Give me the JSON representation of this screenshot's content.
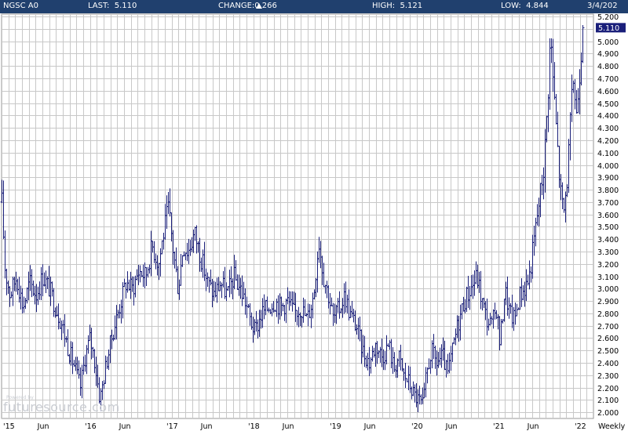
{
  "header": {
    "symbol": "NGSC A0",
    "last_label": "LAST:",
    "last_value": "5.110",
    "change_label": "CHANGE:",
    "change_value": "0.266",
    "change_direction": "up",
    "high_label": "HIGH:",
    "high_value": "5.121",
    "low_label": "LOW:",
    "low_value": "4.844",
    "date": "3/4/202"
  },
  "watermark": {
    "text": "futuresource.com",
    "small": "Powered by"
  },
  "colors": {
    "header_bg": "#20406e",
    "bars": "#1a1f7a",
    "grid": "#c8c8c8",
    "last_badge": "#1a1f7a"
  },
  "chart_data": {
    "type": "ohlc",
    "period": "Weekly",
    "ylim": [
      1.95,
      5.22
    ],
    "ytick_start": 2.0,
    "ytick_step": 0.1,
    "ytick_labels": [
      "2.000",
      "2.100",
      "2.200",
      "2.300",
      "2.400",
      "2.500",
      "2.600",
      "2.700",
      "2.800",
      "2.900",
      "3.000",
      "3.100",
      "3.200",
      "3.300",
      "3.400",
      "3.500",
      "3.600",
      "3.700",
      "3.800",
      "3.900",
      "4.000",
      "4.100",
      "4.200",
      "4.300",
      "4.400",
      "4.500",
      "4.600",
      "4.700",
      "4.800",
      "4.900",
      "5.000",
      "5.100",
      "5.200"
    ],
    "xlim": [
      2015.0,
      2022.25
    ],
    "xticks": [
      {
        "label": "'15",
        "x": 2015.0
      },
      {
        "label": "Jun",
        "x": 2015.42
      },
      {
        "label": "'16",
        "x": 2016.0
      },
      {
        "label": "Jun",
        "x": 2016.42
      },
      {
        "label": "'17",
        "x": 2017.0
      },
      {
        "label": "Jun",
        "x": 2017.42
      },
      {
        "label": "'18",
        "x": 2018.0
      },
      {
        "label": "Jun",
        "x": 2018.42
      },
      {
        "label": "'19",
        "x": 2019.0
      },
      {
        "label": "Jun",
        "x": 2019.42
      },
      {
        "label": "'20",
        "x": 2020.0
      },
      {
        "label": "Jun",
        "x": 2020.42
      },
      {
        "label": "'21",
        "x": 2021.0
      },
      {
        "label": "Jun",
        "x": 2021.42
      },
      {
        "label": "'22",
        "x": 2022.0
      }
    ],
    "last_price": 5.11,
    "last_price_label": "5.110",
    "price_path": [
      [
        2015.0,
        3.7
      ],
      [
        2015.04,
        3.15
      ],
      [
        2015.1,
        2.95
      ],
      [
        2015.18,
        3.1
      ],
      [
        2015.26,
        2.85
      ],
      [
        2015.34,
        3.05
      ],
      [
        2015.42,
        2.95
      ],
      [
        2015.5,
        3.1
      ],
      [
        2015.58,
        3.0
      ],
      [
        2015.66,
        2.85
      ],
      [
        2015.74,
        2.7
      ],
      [
        2015.82,
        2.5
      ],
      [
        2015.9,
        2.35
      ],
      [
        2015.96,
        2.2
      ],
      [
        2016.02,
        2.45
      ],
      [
        2016.08,
        2.6
      ],
      [
        2016.14,
        2.4
      ],
      [
        2016.2,
        2.1
      ],
      [
        2016.28,
        2.4
      ],
      [
        2016.36,
        2.65
      ],
      [
        2016.44,
        2.85
      ],
      [
        2016.52,
        3.05
      ],
      [
        2016.6,
        3.0
      ],
      [
        2016.68,
        3.15
      ],
      [
        2016.76,
        3.1
      ],
      [
        2016.84,
        3.35
      ],
      [
        2016.92,
        3.2
      ],
      [
        2016.98,
        3.45
      ],
      [
        2017.04,
        3.65
      ],
      [
        2017.1,
        3.3
      ],
      [
        2017.16,
        3.0
      ],
      [
        2017.22,
        3.35
      ],
      [
        2017.28,
        3.3
      ],
      [
        2017.36,
        3.45
      ],
      [
        2017.44,
        3.25
      ],
      [
        2017.52,
        3.05
      ],
      [
        2017.6,
        2.95
      ],
      [
        2017.68,
        3.05
      ],
      [
        2017.76,
        2.95
      ],
      [
        2017.84,
        3.1
      ],
      [
        2017.92,
        3.0
      ],
      [
        2017.98,
        2.9
      ],
      [
        2018.04,
        2.75
      ],
      [
        2018.1,
        2.65
      ],
      [
        2018.18,
        2.8
      ],
      [
        2018.26,
        2.85
      ],
      [
        2018.34,
        2.9
      ],
      [
        2018.42,
        2.85
      ],
      [
        2018.5,
        2.9
      ],
      [
        2018.58,
        2.8
      ],
      [
        2018.66,
        2.85
      ],
      [
        2018.74,
        2.75
      ],
      [
        2018.82,
        2.95
      ],
      [
        2018.88,
        3.4
      ],
      [
        2018.94,
        3.1
      ],
      [
        2019.0,
        2.95
      ],
      [
        2019.06,
        2.75
      ],
      [
        2019.14,
        2.85
      ],
      [
        2019.2,
        2.95
      ],
      [
        2019.26,
        2.8
      ],
      [
        2019.34,
        2.7
      ],
      [
        2019.42,
        2.5
      ],
      [
        2019.5,
        2.4
      ],
      [
        2019.58,
        2.55
      ],
      [
        2019.66,
        2.45
      ],
      [
        2019.74,
        2.55
      ],
      [
        2019.8,
        2.35
      ],
      [
        2019.86,
        2.45
      ],
      [
        2019.92,
        2.3
      ],
      [
        2019.98,
        2.25
      ],
      [
        2020.04,
        2.15
      ],
      [
        2020.1,
        2.1
      ],
      [
        2020.16,
        2.05
      ],
      [
        2020.2,
        2.3
      ],
      [
        2020.26,
        2.5
      ],
      [
        2020.32,
        2.4
      ],
      [
        2020.4,
        2.45
      ],
      [
        2020.46,
        2.3
      ],
      [
        2020.52,
        2.5
      ],
      [
        2020.58,
        2.7
      ],
      [
        2020.66,
        2.9
      ],
      [
        2020.74,
        3.0
      ],
      [
        2020.82,
        3.1
      ],
      [
        2020.88,
        2.9
      ],
      [
        2020.94,
        2.75
      ],
      [
        2021.0,
        2.7
      ],
      [
        2021.06,
        2.85
      ],
      [
        2021.1,
        2.55
      ],
      [
        2021.16,
        3.0
      ],
      [
        2021.22,
        2.8
      ],
      [
        2021.28,
        2.75
      ],
      [
        2021.34,
        2.95
      ],
      [
        2021.4,
        3.0
      ],
      [
        2021.46,
        3.1
      ],
      [
        2021.52,
        3.4
      ],
      [
        2021.58,
        3.7
      ],
      [
        2021.64,
        4.0
      ],
      [
        2021.68,
        4.45
      ],
      [
        2021.72,
        5.05
      ],
      [
        2021.76,
        4.6
      ],
      [
        2021.8,
        4.2
      ],
      [
        2021.84,
        3.8
      ],
      [
        2021.88,
        3.6
      ],
      [
        2021.92,
        3.85
      ],
      [
        2021.96,
        4.3
      ],
      [
        2022.0,
        4.7
      ],
      [
        2022.04,
        4.4
      ],
      [
        2022.08,
        4.8
      ],
      [
        2022.12,
        5.11
      ]
    ]
  }
}
